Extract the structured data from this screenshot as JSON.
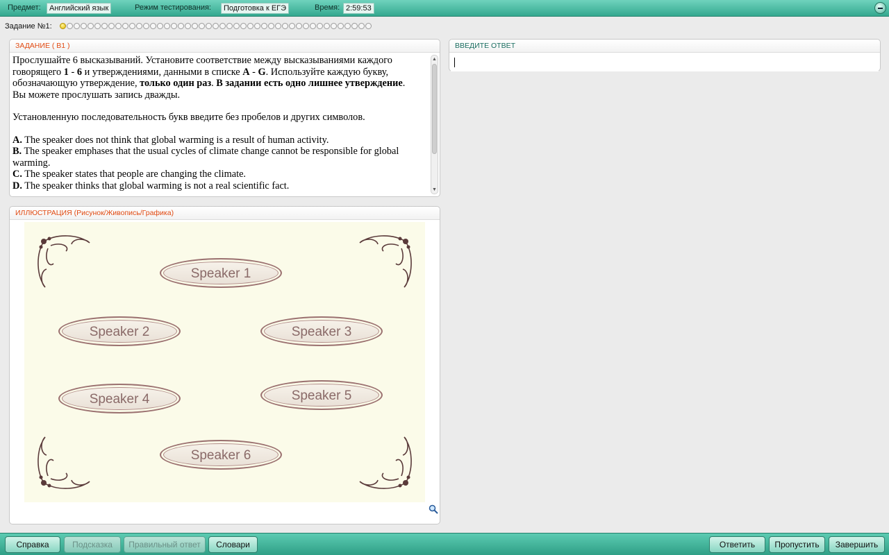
{
  "header": {
    "subject_label": "Предмет:",
    "subject_value": "Английский язык",
    "mode_label": "Режим тестирования:",
    "mode_value": "Подготовка к ЕГЭ",
    "time_label": "Время:",
    "time_value": "2:59:53"
  },
  "progress": {
    "label": "Задание №1:",
    "total": 45,
    "current": 1
  },
  "task_panel": {
    "title": "ЗАДАНИЕ  ( В1 )",
    "intro_1": "Прослушайте 6 высказываний. Установите соответствие между высказываниями каждого говорящего ",
    "intro_b1": "1",
    "intro_2": " - ",
    "intro_b2": "6",
    "intro_3": " и утверждениями, данными в списке ",
    "intro_b3": "A",
    "intro_4": " - ",
    "intro_b4": "G",
    "intro_5": ". Используйте каждую букву, обозначающую утверждение, ",
    "intro_b5": "только один раз",
    "intro_6": ". ",
    "intro_b6": "В задании есть одно лишнее утверждение",
    "intro_7": ".",
    "intro_8": "Вы можете прослушать запись дважды.",
    "instruction": "Установленную последовательность букв введите без пробелов и других символов.",
    "options": [
      {
        "letter": "A.",
        "text": " The speaker does not think that global warming is a result of human activity."
      },
      {
        "letter": "B.",
        "text": " The speaker emphases that the usual cycles of climate change cannot be responsible for global warming."
      },
      {
        "letter": "C.",
        "text": " The speaker states that people are changing the climate."
      },
      {
        "letter": "D.",
        "text": " The speaker thinks that global warming is not a real scientific fact."
      }
    ]
  },
  "answer_panel": {
    "title": "ВВЕДИТЕ ОТВЕТ",
    "value": ""
  },
  "illustration_panel": {
    "title": "ИЛЛЮСТРАЦИЯ (Рисунок/Живопись/Графика)",
    "speakers": [
      "Speaker 1",
      "Speaker 2",
      "Speaker 3",
      "Speaker 4",
      "Speaker 5",
      "Speaker 6"
    ],
    "background_color": "#fbfbe9"
  },
  "footer": {
    "help": "Справка",
    "hint": "Подсказка",
    "correct_answer": "Правильный ответ",
    "dictionaries": "Словари",
    "answer": "Ответить",
    "skip": "Пропустить",
    "finish": "Завершить"
  },
  "colors": {
    "accent": "#3fb59b",
    "panel_title_orange": "#e14a12",
    "panel_title_teal": "#1b6e61"
  }
}
